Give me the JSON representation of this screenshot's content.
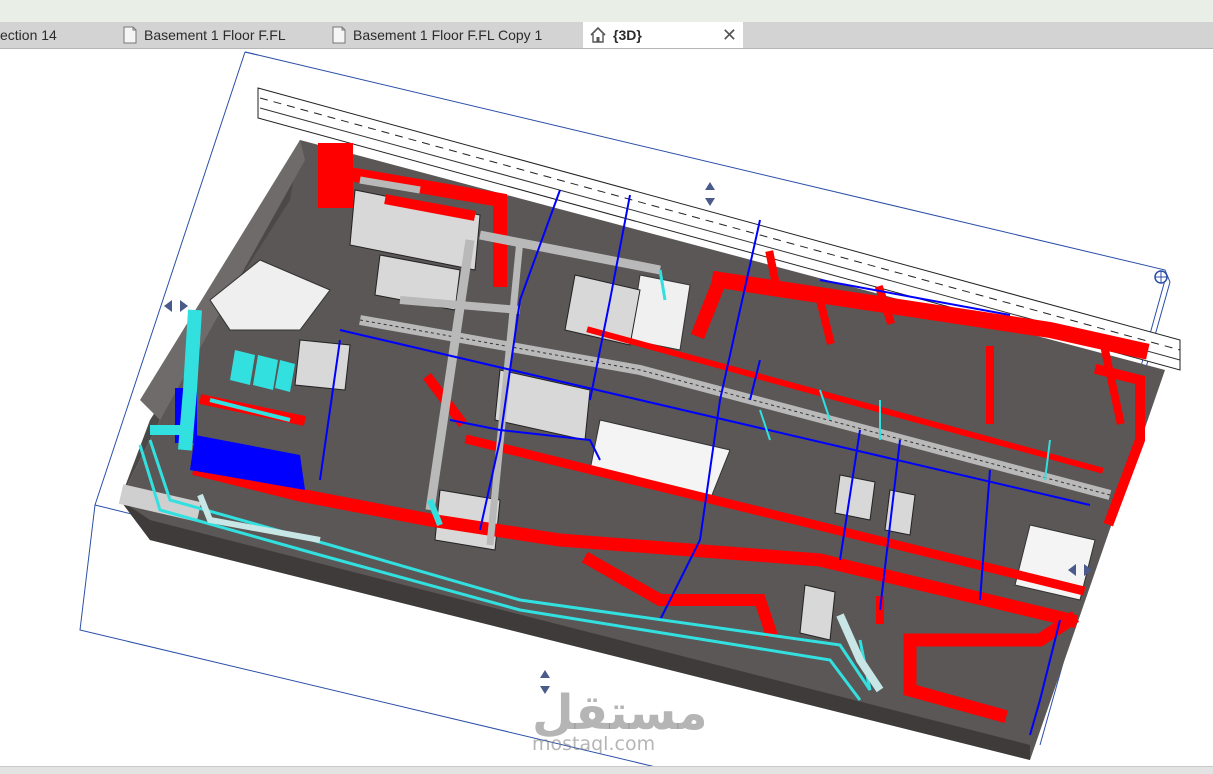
{
  "tabs": [
    {
      "label": "ection 14",
      "active": false,
      "icon": "none"
    },
    {
      "label": "Basement 1 Floor F.FL",
      "active": false,
      "icon": "floor-plan-icon"
    },
    {
      "label": "Basement 1 Floor F.FL Copy 1",
      "active": false,
      "icon": "floor-plan-icon"
    },
    {
      "label": "{3D}",
      "active": true,
      "icon": "3d-house-icon",
      "close": "✕"
    }
  ],
  "watermark": {
    "arabic": "مستقل",
    "latin": "mostaql.com"
  },
  "colors": {
    "slab": "#5a5756",
    "hvac_supply": "#ff0000",
    "hvac_return": "#0000ff",
    "plumbing": "#00e5e5",
    "section_box": "#2b4fa8",
    "tab_bar": "#d3d3d3",
    "tab_active": "#ffffff"
  },
  "viewport": {
    "type": "3d-model-view",
    "content": "MEP basement model"
  }
}
